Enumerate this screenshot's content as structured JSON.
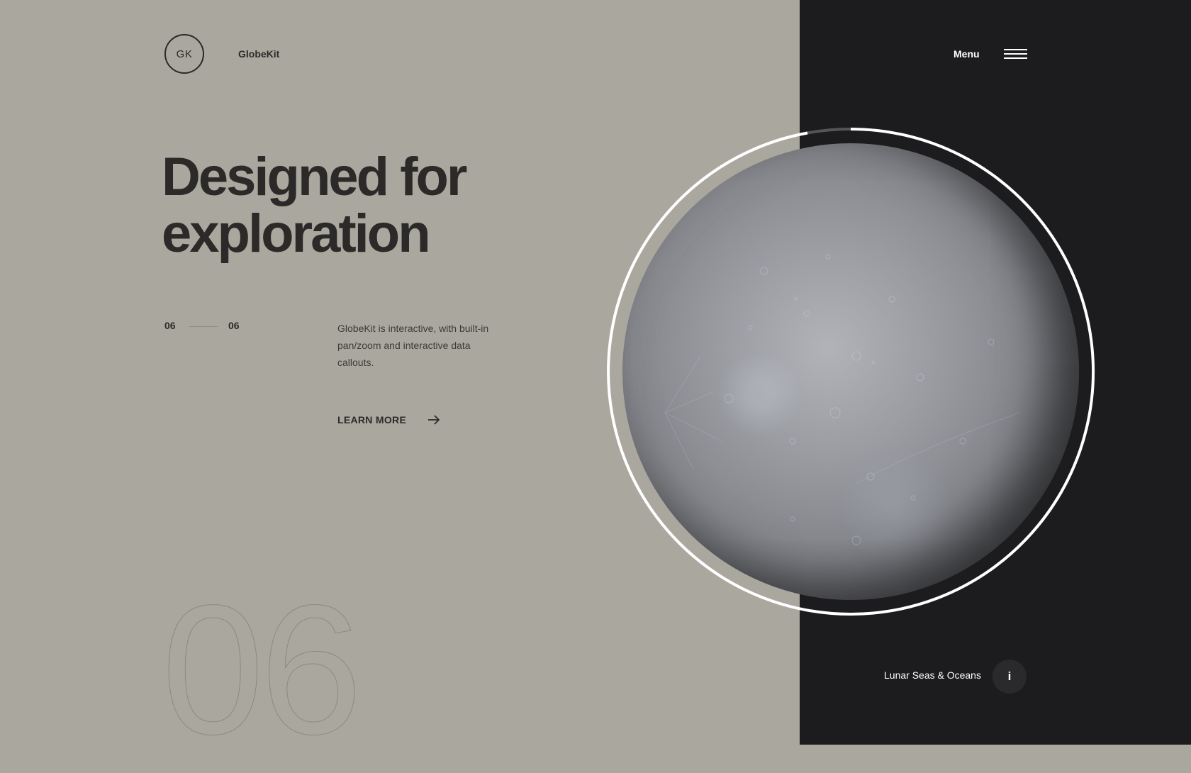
{
  "header": {
    "logo_text": "GK",
    "brand_name": "GlobeKit",
    "menu_label": "Menu"
  },
  "hero": {
    "title_line1": "Designed for",
    "title_line2": "exploration",
    "counter_current": "06",
    "counter_total": "06",
    "description": "GlobeKit is interactive, with built-in pan/zoom and interactive data callouts.",
    "cta_label": "LEARN MORE",
    "big_number": "06"
  },
  "globe": {
    "caption": "Lunar Seas & Oceans",
    "info_button_label": "i"
  },
  "colors": {
    "background_left": "#aaa79f",
    "background_right": "#1c1c1e",
    "text_dark": "#2b2a28",
    "ring": "#ffffff"
  },
  "icons": [
    "logo-circle",
    "hamburger-icon",
    "arrow-right-icon",
    "info-icon"
  ]
}
